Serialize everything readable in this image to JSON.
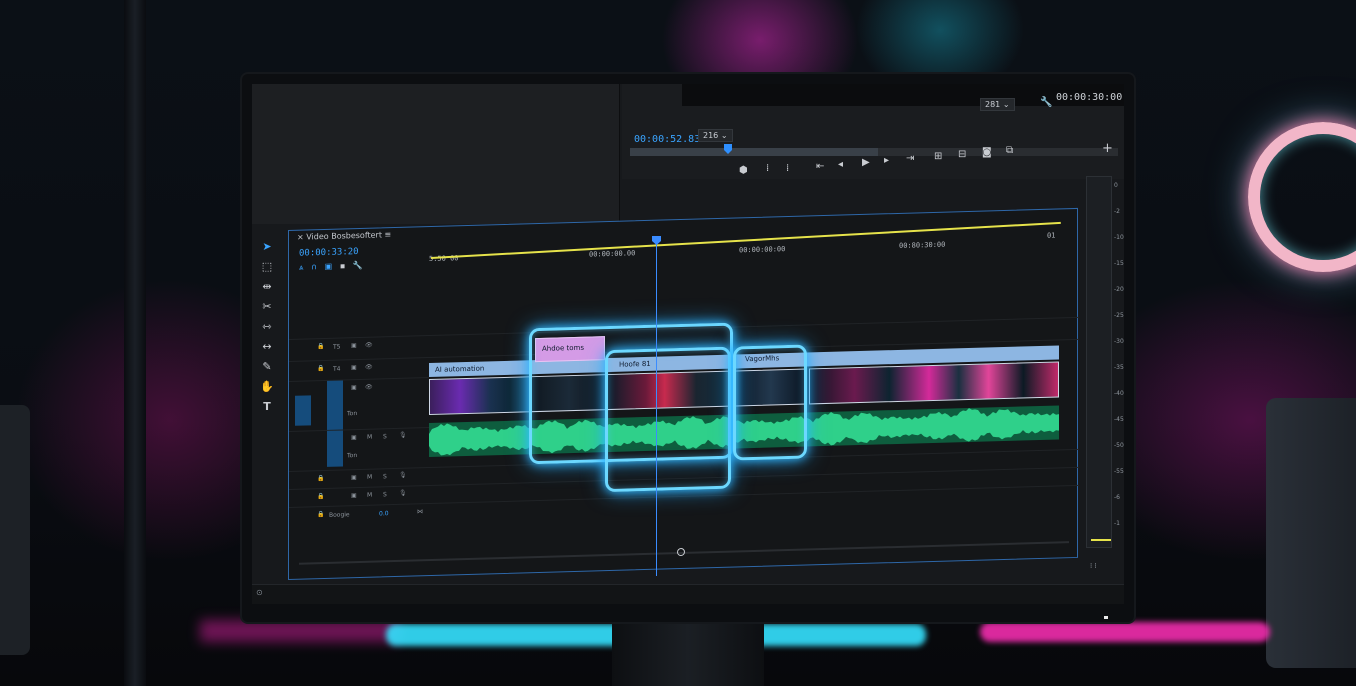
{
  "program_monitor": {
    "timecode_current": "00:00:52.83",
    "timecode_duration": "00:00:30:00",
    "zoom_select": "216",
    "res_select": "281",
    "add_label": "+"
  },
  "timeline": {
    "panel_title": "Video Bosbesoftert",
    "timecode": "00:00:33:20",
    "ruler": [
      "5:50 00",
      "00:00:00.00",
      "00:00:00:00",
      "00:80:30:00",
      "01"
    ],
    "tracks": {
      "v3": "T5",
      "v2": "T4",
      "a1_label": "Ton",
      "a2_label": "Ton",
      "m": "M",
      "s": "S",
      "master": "Boogie",
      "master_val": "0.0"
    },
    "clips": {
      "pink_title": "Ahdoe toms",
      "ai_automation": "AI automation",
      "clip_b": "Hoofe 81",
      "clip_c": "VagorMhs"
    }
  },
  "meter_labels": [
    "0",
    "-2",
    "-10",
    "-15",
    "-20",
    "-25",
    "-30",
    "-35",
    "-40",
    "-45",
    "-50",
    "-55",
    "-6",
    "-1"
  ]
}
